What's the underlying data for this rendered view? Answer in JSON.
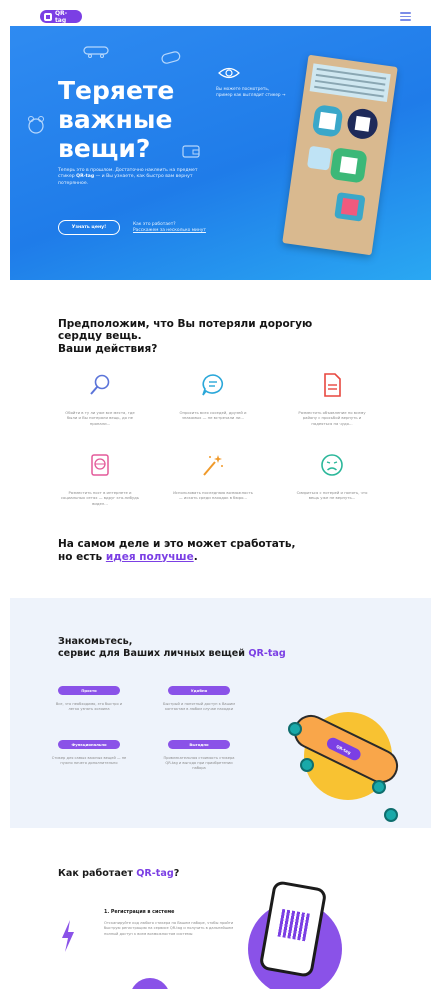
{
  "header": {
    "logo_text": "QR-tag"
  },
  "hero": {
    "title": "Теряете важные вещи?",
    "subtitle_pre": "Теперь это в прошлом. Достаточно наклеить на предмет стикер ",
    "subtitle_brand": "QR-tag",
    "subtitle_post": " — и Вы узнаете, как быстро вам вернут потерянное.",
    "button_label": "Узнать цену!",
    "how_question": "Как это работает?",
    "how_link": "Расскажем за несколько минут",
    "eye_text": "Вы можете посмотреть, пример как выглядит стикер →"
  },
  "section_lost": {
    "title_line1": "Предположим, что Вы потеряли дорогую",
    "title_line2": "сердцу вещь.",
    "title_line3": "Ваши действия?",
    "items": [
      {
        "icon": "magnifier-icon",
        "text": "Обойти в ту ли уже все места, где были и Вы потеряли вещь, до не пропали..."
      },
      {
        "icon": "chat-icon",
        "text": "Опросить всех соседей, друзей и знакомых — не встречали ли..."
      },
      {
        "icon": "document-icon",
        "text": "Разместить объявление по всему району с просьбой вернуть и надеяться на чудо..."
      },
      {
        "icon": "globe-icon",
        "text": "Разместить пост в интернете и социальных сетях — вдруг кто-нибудь видел..."
      },
      {
        "icon": "magic-wand-icon",
        "text": "Использовать последнюю возможность — искать среди находок в бюро..."
      },
      {
        "icon": "sad-face-icon",
        "text": "Смириться с потерей и понять, что вещь уже не вернуть..."
      }
    ],
    "bottom_pre": "На самом деле и это может сработать,",
    "bottom_mid": "но есть ",
    "bottom_link": "идея получше",
    "bottom_post": "."
  },
  "section_meet": {
    "title_line1": "Знакомьтесь,",
    "title_line2_pre": "сервис для Ваших личных вещей ",
    "title_brand": "QR-tag",
    "features": [
      {
        "label": "Просто",
        "text": "Все, что необходимо, это быстро и легко узнать хозяина"
      },
      {
        "label": "Удобно",
        "text": "Быстрый и понятный доступ к Вашим контактам в любом случае находки"
      },
      {
        "label": "Функционально",
        "text": "Стикер для самых важных вещей — не нужно ничего дополнительно"
      },
      {
        "label": "Выгодно",
        "text": "Привлекательная стоимость стикера QR-tag и выгода при приобретении набора"
      }
    ],
    "board_tag": "QR-tag"
  },
  "section_how": {
    "title_pre": "Как работает ",
    "title_brand": "QR-tag",
    "title_post": "?",
    "step_title": "1. Регистрация в системе",
    "step_text": "Отсканируйте код любого стикера на Вашем наборе, чтобы пройти быструю регистрацию на сервисе QR-tag и получить в дальнейшем полный доступ к всем возможностям системы"
  },
  "colors": {
    "accent": "#7b3fe4",
    "hero_blue": "#2f8bf1",
    "section_bg": "#eef3fb",
    "yellow": "#f8c232",
    "icon_blue": "#5b74d9",
    "icon_red": "#e8473f",
    "icon_teal": "#2bb79a",
    "icon_orange": "#f09a2a"
  }
}
